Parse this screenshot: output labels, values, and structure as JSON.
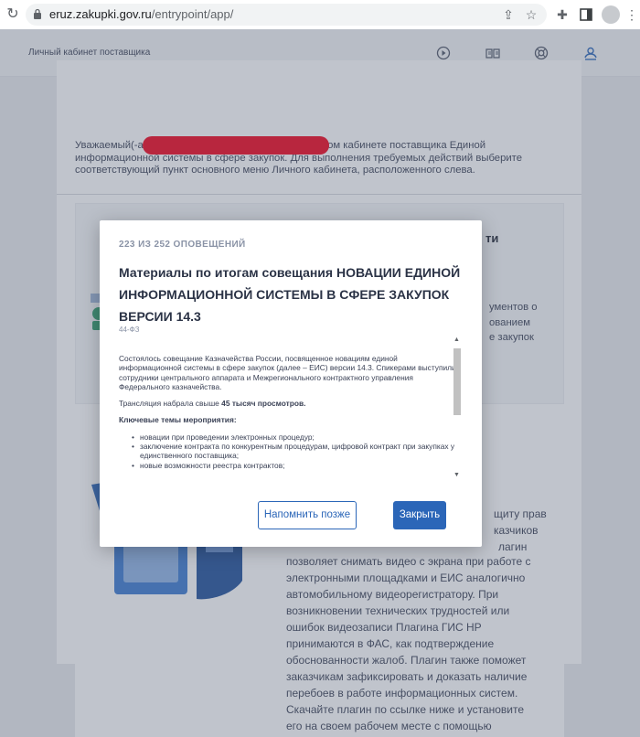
{
  "browser": {
    "url_host": "eruz.zakupki.gov.ru",
    "url_path": "/entrypoint/app/"
  },
  "header": {
    "cabinet_title": "Личный кабинет поставщика"
  },
  "page": {
    "welcome_text": "Уважаемый(-ая) Вы успешно авторизовались в личном кабинете поставщика Единой информационной системы в сфере закупок. Для выполнения требуемых действий выберите соответствующий пункт основного меню Личного кабинета, расположенного слева.",
    "fragment_right_title": "ти",
    "fragment_lines": [
      "ументов о",
      "ованием",
      "е закупок"
    ],
    "fragment_rights": "щиту прав",
    "fragment_customers": "казчиков",
    "fragment_plugin": "лагин",
    "plugin_text": "позволяет снимать видео с экрана при работе с электронными площадками и ЕИС аналогично автомобильному видеорегистратору. При возникновении технических трудностей или ошибок видеозаписи Плагина ГИС НР принимаются в ФАС, как подтверждение обоснованности жалоб. Плагин также поможет заказчикам зафиксировать и доказать наличие перебоев в работе информационных систем. Скачайте плагин по ссылке ниже и установите его на своем рабочем месте с помощью мастера установки."
  },
  "modal": {
    "counter": "223 ИЗ 252 ОПОВЕЩЕНИЙ",
    "title": "Материалы по итогам совещания НОВАЦИИ ЕДИНОЙ ИНФОРМАЦИОННОЙ СИСТЕМЫ В СФЕРЕ ЗАКУПОК ВЕРСИИ 14.3",
    "law": "44-ФЗ",
    "paragraph1": "Состоялось совещание Казначейства России, посвященное новациям единой информационной системы в сфере закупок (далее – ЕИС) версии 14.3. Спикерами выступили сотрудники центрального аппарата и Межрегионального контрактного управления Федерального казначейства.",
    "views_prefix": "Трансляция набрала свыше ",
    "views_bold": "45 тысяч просмотров.",
    "topics_heading": "Ключевые темы мероприятия:",
    "topics": [
      "новации при проведении электронных процедур;",
      "заключение контракта по конкурентным процедурам, цифровой контракт при закупках у единственного поставщика;",
      "новые возможности реестра контрактов;"
    ],
    "remind_label": "Напомнить позже",
    "close_label": "Закрыть"
  }
}
